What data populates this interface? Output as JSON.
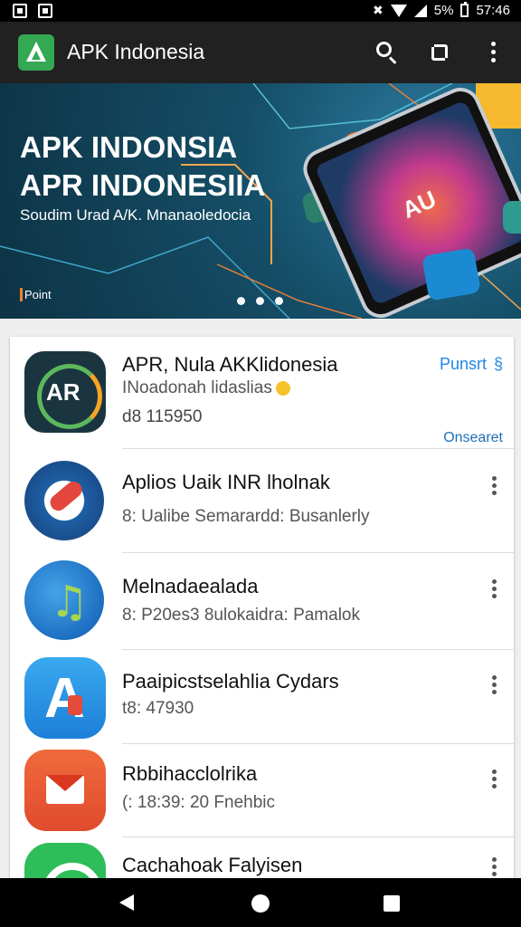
{
  "status_bar": {
    "battery_text": "5%",
    "time": "57:46",
    "icons": [
      "gallery-icon",
      "image-icon",
      "no-calls-icon",
      "wifi-icon",
      "signal-icon",
      "battery-icon"
    ]
  },
  "app_bar": {
    "title": "APK Indonesia",
    "icons": [
      "search-icon",
      "crop-icon",
      "more-vert-icon"
    ]
  },
  "banner": {
    "headline_1": "APK INDONSIA",
    "headline_2": "APR INDONESIIA",
    "subtitle": "Soudim Urad A/K. Mnanaoledocia",
    "point_label": "Point",
    "phone_screen_text": "AU",
    "dots_count": 3,
    "accent_color": "#f5822e"
  },
  "list": {
    "items": [
      {
        "title": "APR, Nula AKKlidonesia",
        "subtitle": "INoadonah lidaslias",
        "meta": "d8 115950",
        "action_label": "Punsrt",
        "action_icon": "§",
        "status": "Onsearet",
        "icon": "ar-app-icon",
        "icon_text": "AR"
      },
      {
        "title": "Aplios Uaik INR lholnak",
        "subtitle": "8: Ualibe Semarardd: Busanlerly",
        "icon": "red-circle-app-icon"
      },
      {
        "title": "Melnadaealada",
        "subtitle": "8: P20es3 8ulokaidra: Pamalok",
        "icon": "music-note-app-icon"
      },
      {
        "title": "Paaipicstselahlia Cydars",
        "subtitle": "t8: 47930",
        "icon": "letter-a-app-icon",
        "icon_text": "A"
      },
      {
        "title": "Rbbihacclolrika",
        "subtitle": "(: 18:39: 20 Fnehbic",
        "icon": "mail-app-icon"
      },
      {
        "title": "Cachahoak Falyisen",
        "icon": "green-app-icon"
      }
    ]
  },
  "nav_bar": {
    "icons": [
      "back-icon",
      "home-icon",
      "recents-icon"
    ]
  },
  "colors": {
    "app_bar_bg": "#212121",
    "accent_blue": "#1e88e5",
    "brand_green": "#34a853",
    "status_bar_bg": "#000000"
  }
}
